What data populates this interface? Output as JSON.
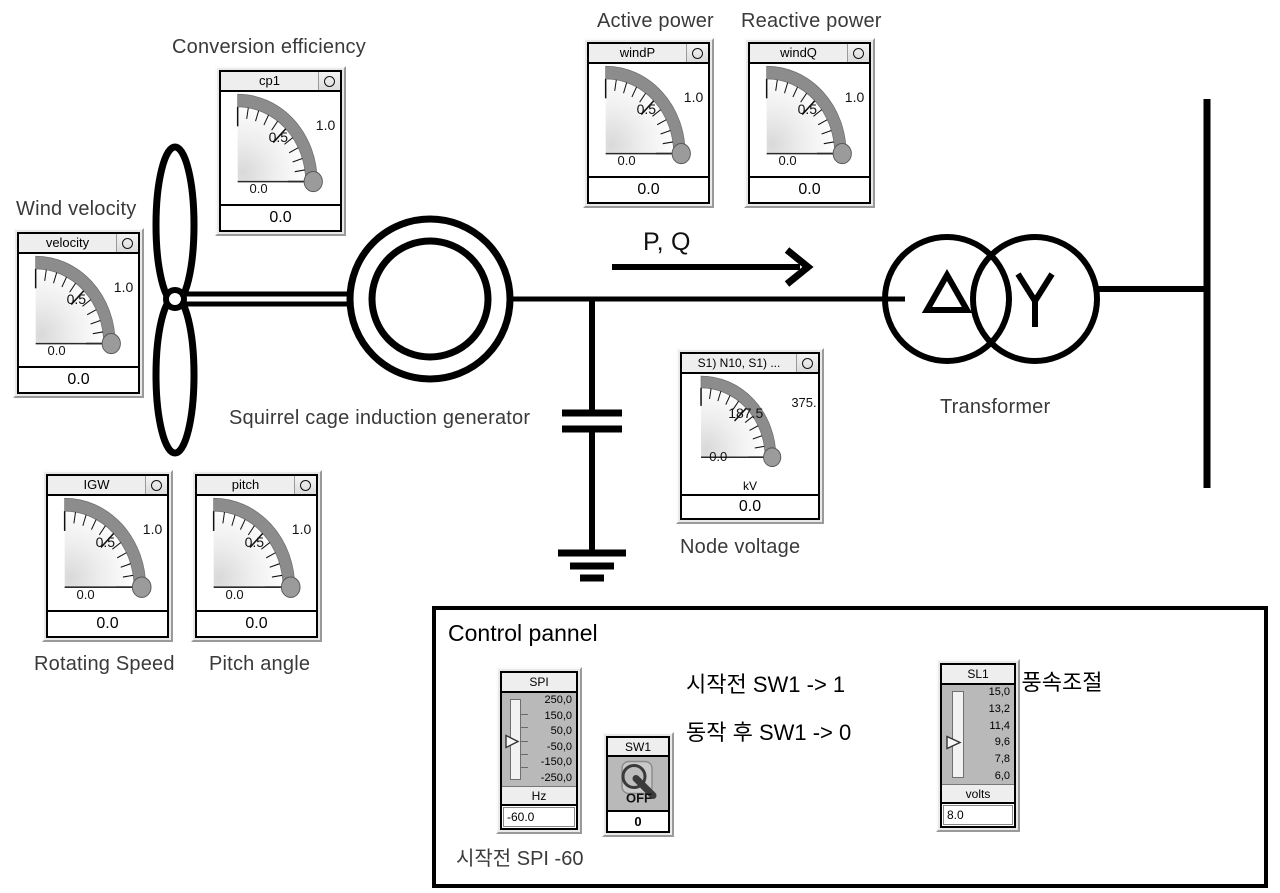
{
  "labels": {
    "wind_velocity": "Wind velocity",
    "conversion_efficiency": "Conversion efficiency",
    "active_power": "Active power",
    "reactive_power": "Reactive power",
    "node_voltage": "Node voltage",
    "rotating_speed": "Rotating Speed",
    "pitch_angle": "Pitch angle",
    "generator": "Squirrel cage induction generator",
    "transformer": "Transformer",
    "pq_arrow": "P, Q"
  },
  "gauges": [
    {
      "id": "velocity",
      "title": "velocity",
      "value": "0.0",
      "scale": {
        "min": "0.0",
        "mid": "0.5",
        "max": "1.0"
      },
      "unit": ""
    },
    {
      "id": "cp1",
      "title": "cp1",
      "value": "0.0",
      "scale": {
        "min": "0.0",
        "mid": "0.5",
        "max": "1.0"
      },
      "unit": ""
    },
    {
      "id": "windP",
      "title": "windP",
      "value": "0.0",
      "scale": {
        "min": "0.0",
        "mid": "0.5",
        "max": "1.0"
      },
      "unit": ""
    },
    {
      "id": "windQ",
      "title": "windQ",
      "value": "0.0",
      "scale": {
        "min": "0.0",
        "mid": "0.5",
        "max": "1.0"
      },
      "unit": ""
    },
    {
      "id": "node",
      "title": "S1) N10, S1) ...",
      "value": "0.0",
      "scale": {
        "min": "0.0",
        "mid": "187.5",
        "max": "375."
      },
      "unit": "kV"
    },
    {
      "id": "igw",
      "title": "IGW",
      "value": "0.0",
      "scale": {
        "min": "0.0",
        "mid": "0.5",
        "max": "1.0"
      },
      "unit": ""
    },
    {
      "id": "pitch",
      "title": "pitch",
      "value": "0.0",
      "scale": {
        "min": "0.0",
        "mid": "0.5",
        "max": "1.0"
      },
      "unit": ""
    }
  ],
  "control_panel": {
    "title": "Control pannel",
    "note_spi": "시작전 SPI -60",
    "instruction_1": "시작전 SW1 -> 1",
    "instruction_2": "동작 후 SW1 -> 0",
    "sl1_note": "SL1 : 풍속조절",
    "spi": {
      "title": "SPI",
      "unit": "Hz",
      "value": "-60.0",
      "ticks": [
        "250,0",
        "150,0",
        "50,0",
        "-50,0",
        "-150,0",
        "-250,0"
      ]
    },
    "sw1": {
      "title": "SW1",
      "state_label": "OFF",
      "value": "0"
    },
    "sl1": {
      "title": "SL1",
      "unit": "volts",
      "value": "8.0",
      "ticks": [
        "15,0",
        "13,2",
        "11,4",
        "9,6",
        "7,8",
        "6,0"
      ]
    }
  },
  "colors": {
    "arc": "#8c8c8c",
    "panel_face": "#e9e9e9",
    "slider_bg": "#b9b9b9",
    "title_bg": "#eeeeee",
    "line": "#000000",
    "caption": "#3a3a3a"
  }
}
